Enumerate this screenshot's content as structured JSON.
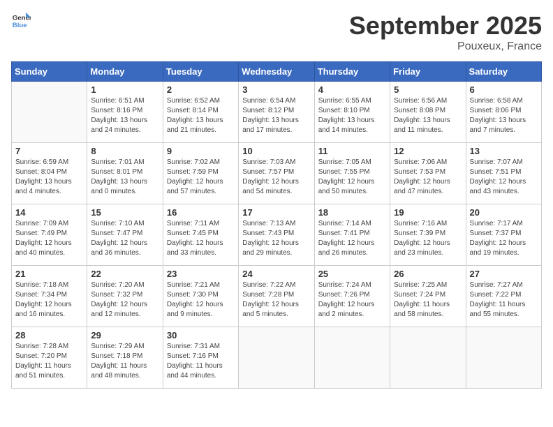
{
  "logo": {
    "general": "General",
    "blue": "Blue"
  },
  "title": "September 2025",
  "location": "Pouxeux, France",
  "days_header": [
    "Sunday",
    "Monday",
    "Tuesday",
    "Wednesday",
    "Thursday",
    "Friday",
    "Saturday"
  ],
  "weeks": [
    [
      {
        "day": "",
        "info": ""
      },
      {
        "day": "1",
        "info": "Sunrise: 6:51 AM\nSunset: 8:16 PM\nDaylight: 13 hours\nand 24 minutes."
      },
      {
        "day": "2",
        "info": "Sunrise: 6:52 AM\nSunset: 8:14 PM\nDaylight: 13 hours\nand 21 minutes."
      },
      {
        "day": "3",
        "info": "Sunrise: 6:54 AM\nSunset: 8:12 PM\nDaylight: 13 hours\nand 17 minutes."
      },
      {
        "day": "4",
        "info": "Sunrise: 6:55 AM\nSunset: 8:10 PM\nDaylight: 13 hours\nand 14 minutes."
      },
      {
        "day": "5",
        "info": "Sunrise: 6:56 AM\nSunset: 8:08 PM\nDaylight: 13 hours\nand 11 minutes."
      },
      {
        "day": "6",
        "info": "Sunrise: 6:58 AM\nSunset: 8:06 PM\nDaylight: 13 hours\nand 7 minutes."
      }
    ],
    [
      {
        "day": "7",
        "info": "Sunrise: 6:59 AM\nSunset: 8:04 PM\nDaylight: 13 hours\nand 4 minutes."
      },
      {
        "day": "8",
        "info": "Sunrise: 7:01 AM\nSunset: 8:01 PM\nDaylight: 13 hours\nand 0 minutes."
      },
      {
        "day": "9",
        "info": "Sunrise: 7:02 AM\nSunset: 7:59 PM\nDaylight: 12 hours\nand 57 minutes."
      },
      {
        "day": "10",
        "info": "Sunrise: 7:03 AM\nSunset: 7:57 PM\nDaylight: 12 hours\nand 54 minutes."
      },
      {
        "day": "11",
        "info": "Sunrise: 7:05 AM\nSunset: 7:55 PM\nDaylight: 12 hours\nand 50 minutes."
      },
      {
        "day": "12",
        "info": "Sunrise: 7:06 AM\nSunset: 7:53 PM\nDaylight: 12 hours\nand 47 minutes."
      },
      {
        "day": "13",
        "info": "Sunrise: 7:07 AM\nSunset: 7:51 PM\nDaylight: 12 hours\nand 43 minutes."
      }
    ],
    [
      {
        "day": "14",
        "info": "Sunrise: 7:09 AM\nSunset: 7:49 PM\nDaylight: 12 hours\nand 40 minutes."
      },
      {
        "day": "15",
        "info": "Sunrise: 7:10 AM\nSunset: 7:47 PM\nDaylight: 12 hours\nand 36 minutes."
      },
      {
        "day": "16",
        "info": "Sunrise: 7:11 AM\nSunset: 7:45 PM\nDaylight: 12 hours\nand 33 minutes."
      },
      {
        "day": "17",
        "info": "Sunrise: 7:13 AM\nSunset: 7:43 PM\nDaylight: 12 hours\nand 29 minutes."
      },
      {
        "day": "18",
        "info": "Sunrise: 7:14 AM\nSunset: 7:41 PM\nDaylight: 12 hours\nand 26 minutes."
      },
      {
        "day": "19",
        "info": "Sunrise: 7:16 AM\nSunset: 7:39 PM\nDaylight: 12 hours\nand 23 minutes."
      },
      {
        "day": "20",
        "info": "Sunrise: 7:17 AM\nSunset: 7:37 PM\nDaylight: 12 hours\nand 19 minutes."
      }
    ],
    [
      {
        "day": "21",
        "info": "Sunrise: 7:18 AM\nSunset: 7:34 PM\nDaylight: 12 hours\nand 16 minutes."
      },
      {
        "day": "22",
        "info": "Sunrise: 7:20 AM\nSunset: 7:32 PM\nDaylight: 12 hours\nand 12 minutes."
      },
      {
        "day": "23",
        "info": "Sunrise: 7:21 AM\nSunset: 7:30 PM\nDaylight: 12 hours\nand 9 minutes."
      },
      {
        "day": "24",
        "info": "Sunrise: 7:22 AM\nSunset: 7:28 PM\nDaylight: 12 hours\nand 5 minutes."
      },
      {
        "day": "25",
        "info": "Sunrise: 7:24 AM\nSunset: 7:26 PM\nDaylight: 12 hours\nand 2 minutes."
      },
      {
        "day": "26",
        "info": "Sunrise: 7:25 AM\nSunset: 7:24 PM\nDaylight: 11 hours\nand 58 minutes."
      },
      {
        "day": "27",
        "info": "Sunrise: 7:27 AM\nSunset: 7:22 PM\nDaylight: 11 hours\nand 55 minutes."
      }
    ],
    [
      {
        "day": "28",
        "info": "Sunrise: 7:28 AM\nSunset: 7:20 PM\nDaylight: 11 hours\nand 51 minutes."
      },
      {
        "day": "29",
        "info": "Sunrise: 7:29 AM\nSunset: 7:18 PM\nDaylight: 11 hours\nand 48 minutes."
      },
      {
        "day": "30",
        "info": "Sunrise: 7:31 AM\nSunset: 7:16 PM\nDaylight: 11 hours\nand 44 minutes."
      },
      {
        "day": "",
        "info": ""
      },
      {
        "day": "",
        "info": ""
      },
      {
        "day": "",
        "info": ""
      },
      {
        "day": "",
        "info": ""
      }
    ]
  ]
}
